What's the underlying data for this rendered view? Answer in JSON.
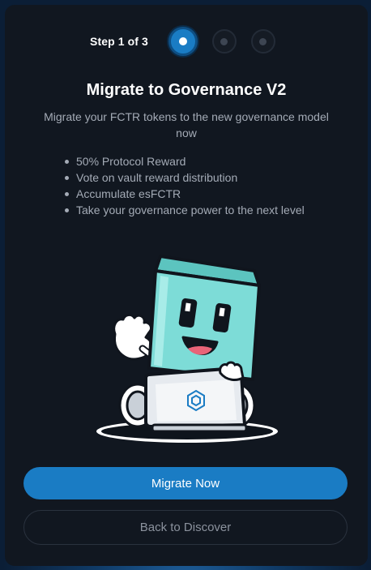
{
  "stepper": {
    "label": "Step 1 of 3",
    "total_steps": 3,
    "current_step": 1
  },
  "title": "Migrate to Governance V2",
  "subtitle": "Migrate your FCTR tokens to the new governance model now",
  "bullets": [
    "50% Protocol Reward",
    "Vote on vault reward distribution",
    "Accumulate esFCTR",
    "Take your governance power to the next level"
  ],
  "buttons": {
    "primary_label": "Migrate Now",
    "secondary_label": "Back to Discover"
  },
  "colors": {
    "accent": "#1a7cc4",
    "modal_bg": "#111720",
    "mascot": "#7ddcd7"
  }
}
